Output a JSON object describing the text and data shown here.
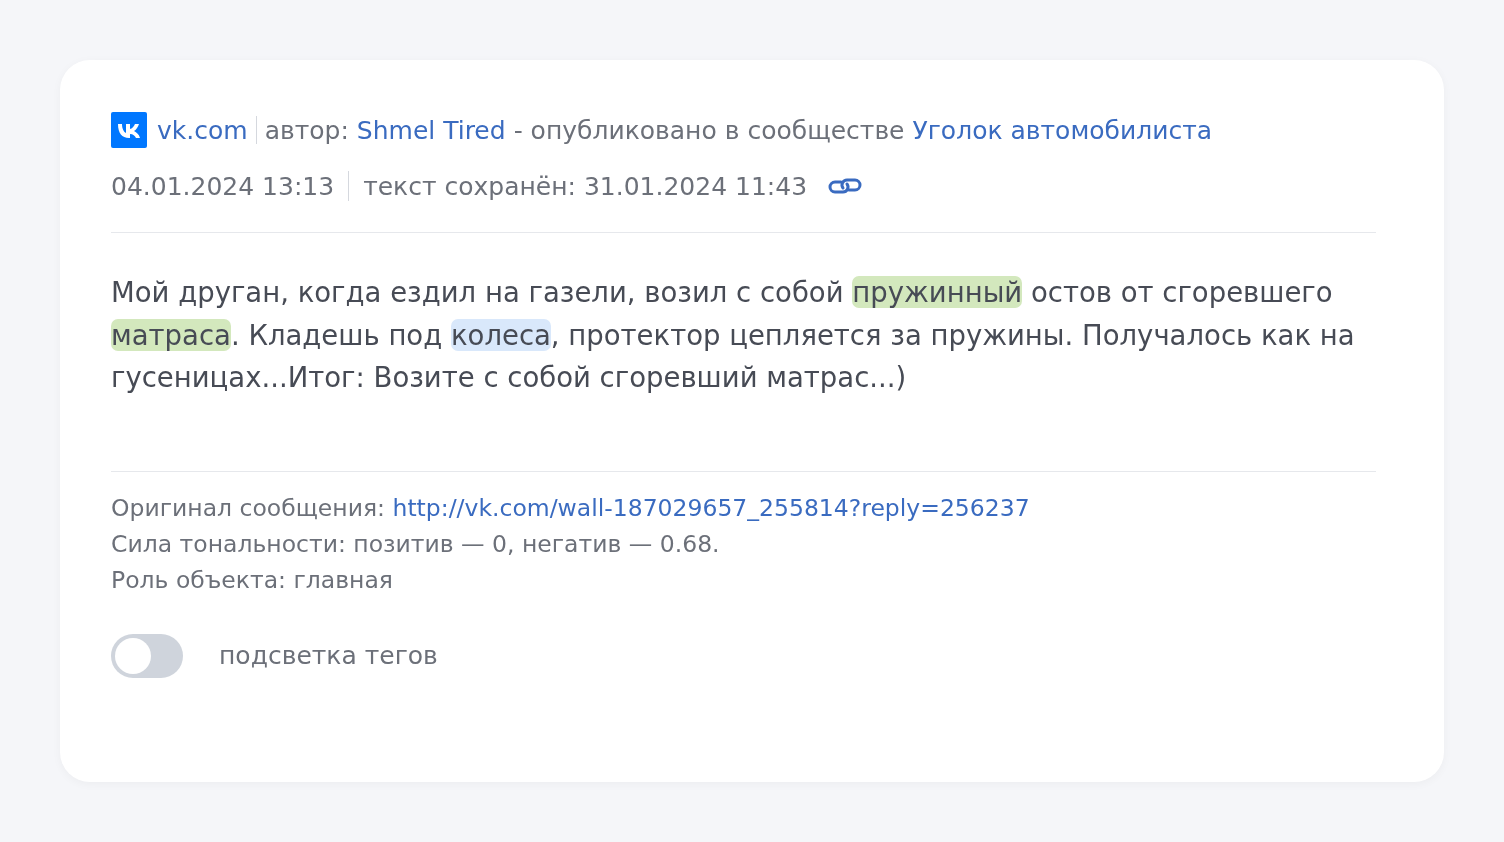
{
  "source": {
    "site": "vk.com",
    "author_label": "автор:",
    "author": "Shmel Tired",
    "published_label": "- опубликовано в сообществе",
    "community": "Уголок автомобилиста"
  },
  "dates": {
    "posted": "04.01.2024 13:13",
    "saved": "текст сохранён: 31.01.2024 11:43"
  },
  "body": [
    {
      "text": "Мой друган, когда ездил на газели, возил с собой "
    },
    {
      "text": "пружинный",
      "color": "#d3e8bd"
    },
    {
      "text": " остов от сгоревшего "
    },
    {
      "text": "матраса",
      "color": "#d3e8bd"
    },
    {
      "text": ". Кладешь под "
    },
    {
      "text": "колеса",
      "color": "#d9e8fb"
    },
    {
      "text": ", протектор цепляется за пружины. Получалось как на гусеницах...Итог: Возите с собой сгоревший матрас...)"
    }
  ],
  "details": {
    "original_label": "Оригинал сообщения:",
    "original_url": "http://vk.com/wall-187029657_255814?reply=256237",
    "tonality": "Сила тональности: позитив — 0, негатив — 0.68.",
    "role": "Роль объекта: главная"
  },
  "tag_highlight": {
    "label": "подсветка тегов",
    "on": false
  }
}
